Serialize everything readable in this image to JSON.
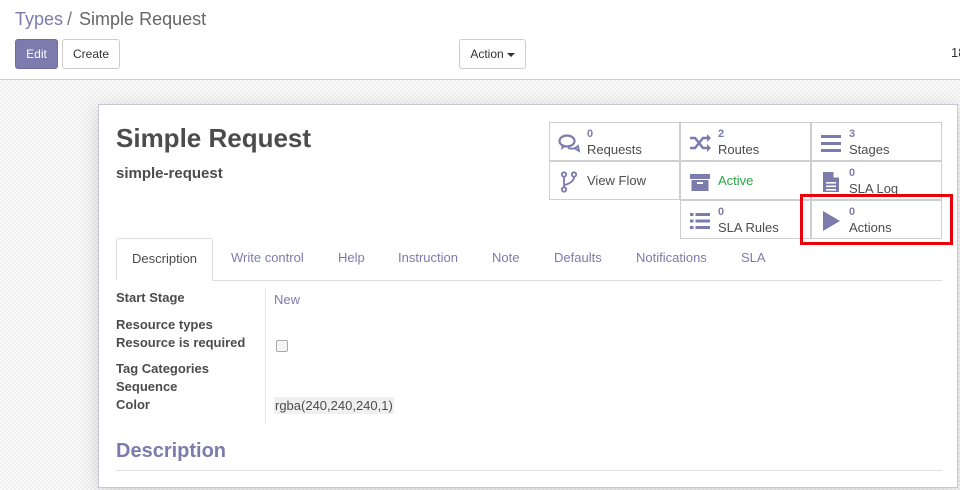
{
  "breadcrumb": {
    "parent": "Types",
    "separator": "/",
    "current": "Simple Request"
  },
  "toolbar": {
    "edit_label": "Edit",
    "create_label": "Create",
    "action_label": "Action"
  },
  "pager": {
    "text": "18"
  },
  "record": {
    "name": "Simple Request",
    "code": "simple-request"
  },
  "stat_buttons": {
    "requests": {
      "count": "0",
      "label": "Requests",
      "icon": "comments-icon"
    },
    "routes": {
      "count": "2",
      "label": "Routes",
      "icon": "shuffle-icon"
    },
    "stages": {
      "count": "3",
      "label": "Stages",
      "icon": "bars-icon"
    },
    "view_flow": {
      "label": "View Flow",
      "icon": "code-fork-icon"
    },
    "active": {
      "label": "Active",
      "icon": "archive-icon",
      "color": "#28a745"
    },
    "sla_log": {
      "count": "0",
      "label": "SLA Log",
      "icon": "file-text-icon"
    },
    "sla_rules": {
      "count": "0",
      "label": "SLA Rules",
      "icon": "list-icon"
    },
    "actions": {
      "count": "0",
      "label": "Actions",
      "icon": "play-icon"
    }
  },
  "tabs": [
    "Description",
    "Write control",
    "Help",
    "Instruction",
    "Note",
    "Defaults",
    "Notifications",
    "SLA"
  ],
  "fields": {
    "start_stage": {
      "label": "Start Stage",
      "value": "New"
    },
    "resource_types": {
      "label": "Resource types"
    },
    "resource_required": {
      "label": "Resource is required",
      "checked": false
    },
    "tag_categories": {
      "label": "Tag Categories"
    },
    "sequence": {
      "label": "Sequence"
    },
    "color": {
      "label": "Color",
      "value": "rgba(240,240,240,1)"
    }
  },
  "section": {
    "title": "Description"
  },
  "colors": {
    "accent": "#7c7bad",
    "highlight": "#e8000b",
    "active_green": "#28a745"
  }
}
